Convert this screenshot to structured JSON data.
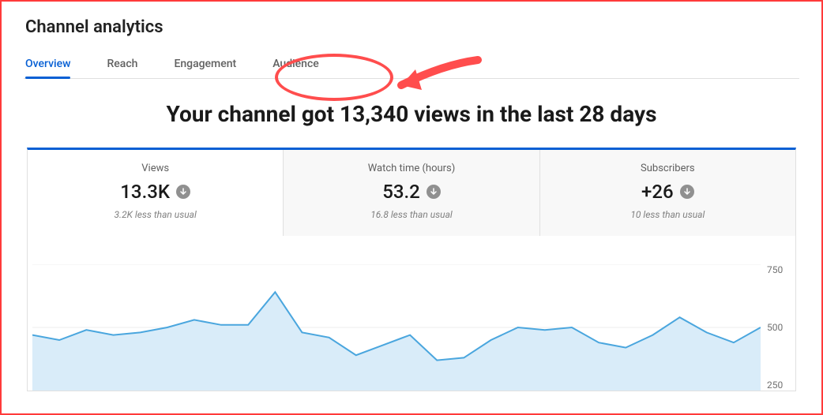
{
  "page_title": "Channel analytics",
  "tabs": [
    {
      "label": "Overview",
      "active": true
    },
    {
      "label": "Reach",
      "active": false
    },
    {
      "label": "Engagement",
      "active": false
    },
    {
      "label": "Audience",
      "active": false
    }
  ],
  "headline": "Your channel got 13,340 views in the last 28 days",
  "metrics": [
    {
      "label": "Views",
      "value": "13.3K",
      "sub": "3.2K less than usual",
      "trend": "down",
      "selected": true
    },
    {
      "label": "Watch time (hours)",
      "value": "53.2",
      "sub": "16.8 less than usual",
      "trend": "down",
      "selected": false
    },
    {
      "label": "Subscribers",
      "value": "+26",
      "sub": "10 less than usual",
      "trend": "down",
      "selected": false
    }
  ],
  "chart_data": {
    "type": "line",
    "title": "",
    "xlabel": "",
    "ylabel": "",
    "ylim": [
      250,
      750
    ],
    "y_ticks": [
      750,
      500,
      250
    ],
    "x": [
      0,
      1,
      2,
      3,
      4,
      5,
      6,
      7,
      8,
      9,
      10,
      11,
      12,
      13,
      14,
      15,
      16,
      17,
      18,
      19,
      20,
      21,
      22,
      23,
      24,
      25,
      26,
      27
    ],
    "values": [
      470,
      450,
      490,
      470,
      480,
      500,
      530,
      510,
      510,
      640,
      480,
      460,
      390,
      430,
      470,
      370,
      380,
      450,
      500,
      490,
      500,
      440,
      420,
      470,
      540,
      480,
      440,
      500
    ]
  },
  "annotation": {
    "circled_tab": "Audience"
  }
}
